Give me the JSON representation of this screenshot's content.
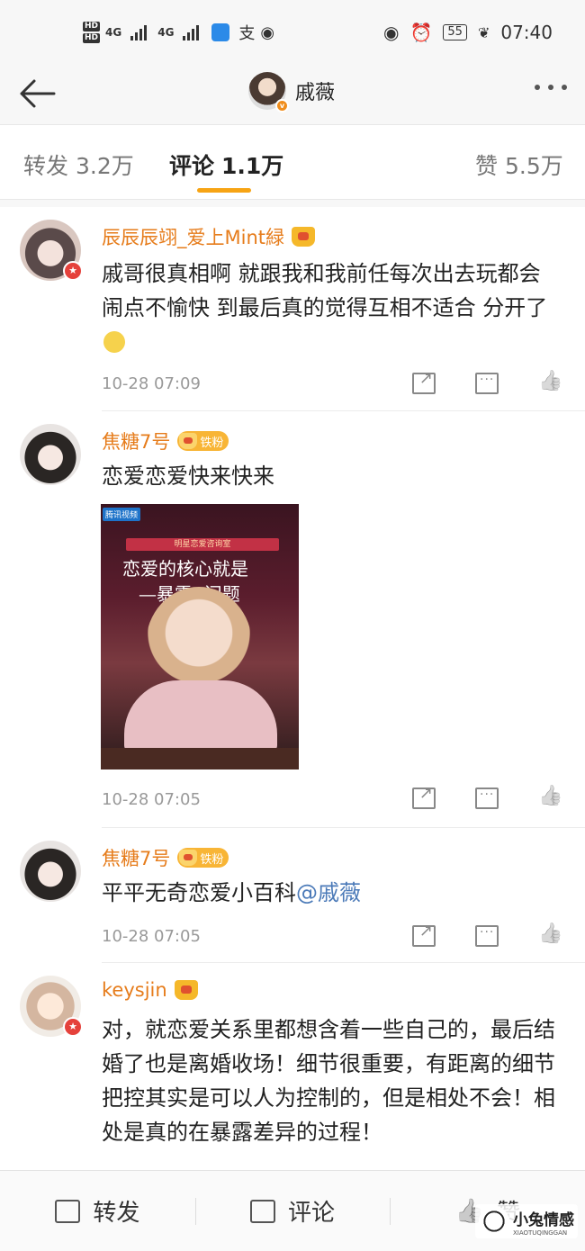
{
  "status_bar": {
    "hd1": "HD",
    "hd2": "HD",
    "net1": "4G",
    "net2": "4G",
    "battery": "55",
    "time": "07:40"
  },
  "header": {
    "title": "戚薇",
    "verified_badge": "v"
  },
  "tabs": [
    {
      "label": "转发",
      "count": "3.2万"
    },
    {
      "label": "评论",
      "count": "1.1万"
    },
    {
      "label": "赞",
      "count": "5.5万"
    }
  ],
  "comments": [
    {
      "user": "辰辰辰翊_爱上Mint緑",
      "text": "戚哥很真相啊 就跟我和我前任每次出去玩都会闹点不愉快 到最后真的觉得互相不适合 分开了",
      "time": "10-28 07:09"
    },
    {
      "user": "焦糖7号",
      "fan_badge": "铁粉",
      "text": "恋爱恋爱快来快来",
      "time": "10-28 07:05",
      "image": {
        "logo": "腾讯视频",
        "banner": "明星恋爱咨询室",
        "title_line1": "恋爱的核心就是",
        "title_line2": "—暴露",
        "title_line3": "问题"
      }
    },
    {
      "user": "焦糖7号",
      "fan_badge": "铁粉",
      "text": "平平无奇恋爱小百科",
      "mention": "@戚薇",
      "time": "10-28 07:05"
    },
    {
      "user": "keysjin",
      "text": "对，就恋爱关系里都想含着一些自己的，最后结婚了也是离婚收场！细节很重要，有距离的细节把控其实是可以人为控制的，但是相处不会！相处是真的在暴露差异的过程！"
    }
  ],
  "bottom_bar": {
    "repost": "转发",
    "comment": "评论",
    "like": "赞"
  },
  "watermark": {
    "name": "小兔情感",
    "url": "XIAOTUQINGGAN"
  }
}
